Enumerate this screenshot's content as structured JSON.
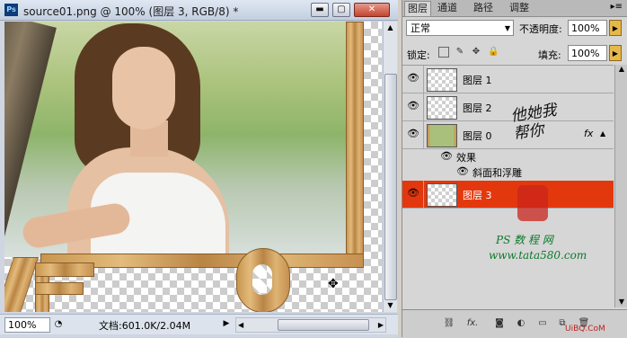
{
  "document": {
    "title": "source01.png @ 100% (图层 3, RGB/8) *",
    "app_icon": "Ps",
    "window_buttons": {
      "minimize": "▬",
      "maximize": "▢",
      "close": "✕"
    },
    "zoom": "100%",
    "doc_info": "文档:601.0K/2.04M",
    "status_arrow": "▶",
    "cursor": "✥",
    "scroll": {
      "up": "▲",
      "down": "▼",
      "left": "◀",
      "right": "▶"
    }
  },
  "panel": {
    "tabs": [
      "图层",
      "通道",
      "路径",
      "调整"
    ],
    "menu_icon": "▸≡",
    "blend_mode": "正常",
    "opacity_label": "不透明度:",
    "opacity": "100%",
    "lock_label": "锁定:",
    "fill_label": "填充:",
    "fill": "100%",
    "layers": [
      {
        "name": "图层 1",
        "visible": true
      },
      {
        "name": "图层 2",
        "visible": true
      },
      {
        "name": "图层 0",
        "visible": true,
        "fx": "fx"
      },
      {
        "name": "图层 3",
        "visible": true,
        "selected": true
      }
    ],
    "effects_label": "效果",
    "bevel_label": "斜面和浮雕",
    "bottom_icons": [
      "link-icon",
      "fx-icon",
      "mask-icon",
      "adjustment-icon",
      "folder-icon",
      "new-layer-icon",
      "trash-icon"
    ]
  },
  "watermark": {
    "calligraphy": "他她我帮你",
    "brand": "PS 数 程 网",
    "url": "www.tata580.com",
    "bottom_tag": "UiBQ.CoM"
  },
  "colors": {
    "selected_layer": "#e3380e",
    "accent_arrow": "#e6b84a"
  }
}
